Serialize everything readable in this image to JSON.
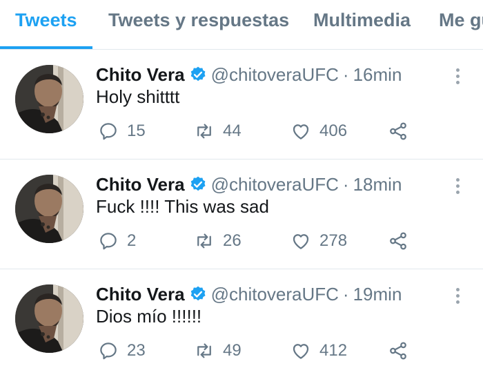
{
  "tabs": [
    {
      "label": "Tweets",
      "active": true
    },
    {
      "label": "Tweets y respuestas",
      "active": false
    },
    {
      "label": "Multimedia",
      "active": false
    },
    {
      "label": "Me gusta",
      "active": false
    }
  ],
  "colors": {
    "accent": "#1da1f2",
    "muted": "#657786",
    "text": "#14171a"
  },
  "tweets": [
    {
      "name": "Chito Vera",
      "handle": "@chitoveraUFC",
      "separator": "·",
      "time": "16min",
      "text": "Holy shitttt",
      "replies": "15",
      "retweets": "44",
      "likes": "406"
    },
    {
      "name": "Chito Vera",
      "handle": "@chitoveraUFC",
      "separator": "·",
      "time": "18min",
      "text": "Fuck !!!! This was sad",
      "replies": "2",
      "retweets": "26",
      "likes": "278"
    },
    {
      "name": "Chito Vera",
      "handle": "@chitoveraUFC",
      "separator": "·",
      "time": "19min",
      "text": "Dios mío !!!!!!",
      "replies": "23",
      "retweets": "49",
      "likes": "412"
    }
  ],
  "icons": {
    "verified": "verified-badge-icon",
    "reply": "reply-icon",
    "retweet": "retweet-icon",
    "like": "heart-icon",
    "share": "share-icon",
    "more": "more-options-icon"
  }
}
